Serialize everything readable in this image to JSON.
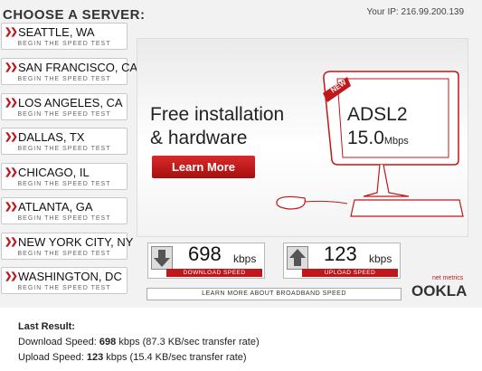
{
  "sidebar": {
    "title": "CHOOSE A SERVER:",
    "subtitle": "BEGIN THE SPEED TEST",
    "items": [
      {
        "label": "SEATTLE, WA"
      },
      {
        "label": "SAN FRANCISCO, CA"
      },
      {
        "label": "LOS ANGELES, CA"
      },
      {
        "label": "DALLAS, TX"
      },
      {
        "label": "CHICAGO, IL"
      },
      {
        "label": "ATLANTA, GA"
      },
      {
        "label": "NEW YORK CITY, NY"
      },
      {
        "label": "WASHINGTON, DC"
      }
    ]
  },
  "header": {
    "ip_text": "Your IP: 216.99.200.139"
  },
  "ad": {
    "line1": "Free installation",
    "line2": "& hardware",
    "button": "Learn More",
    "badge": "NEW",
    "product": "ADSL2",
    "speed_value": "15.0",
    "speed_unit": "Mbps"
  },
  "download": {
    "value": "698",
    "unit": "kbps",
    "label": "DOWNLOAD SPEED"
  },
  "upload": {
    "value": "123",
    "unit": "kbps",
    "label": "UPLOAD SPEED"
  },
  "learn_link": "LEARN MORE ABOUT BROADBAND SPEED",
  "brand": {
    "name": "OOKLA",
    "tagline": "net metrics"
  },
  "result": {
    "title": "Last Result:",
    "download_label": "Download Speed:",
    "download_value": "698",
    "download_rest": "kbps (87.3 KB/sec transfer rate)",
    "upload_label": "Upload Speed:",
    "upload_value": "123",
    "upload_rest": "kbps (15.4 KB/sec transfer rate)"
  },
  "colors": {
    "accent": "#c0171a"
  }
}
